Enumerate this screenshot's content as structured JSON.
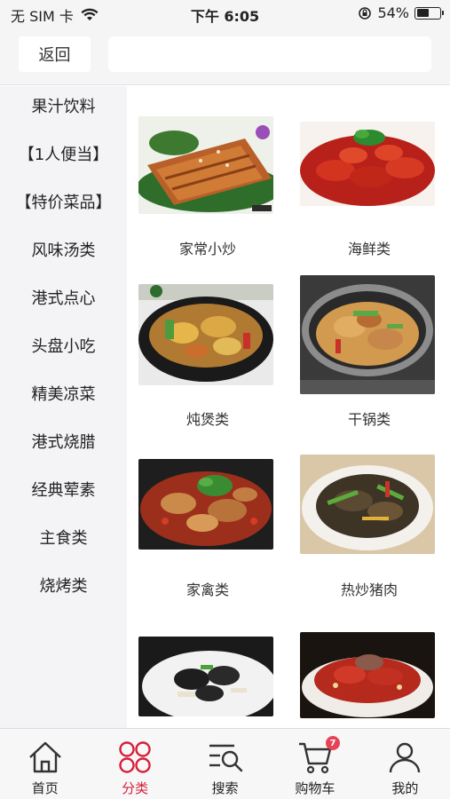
{
  "status_bar": {
    "carrier": "无 SIM 卡",
    "time": "下午 6:05",
    "battery_percent": "54%",
    "battery_level": 0.54
  },
  "nav": {
    "back_label": "返回",
    "search_placeholder": ""
  },
  "sidebar": {
    "items": [
      {
        "label": "果汁饮料"
      },
      {
        "label": "【1人便当】"
      },
      {
        "label": "【特价菜品】"
      },
      {
        "label": "风味汤类"
      },
      {
        "label": "港式点心"
      },
      {
        "label": "头盘小吃"
      },
      {
        "label": "精美凉菜"
      },
      {
        "label": "港式烧腊"
      },
      {
        "label": "经典荤素"
      },
      {
        "label": "主食类"
      },
      {
        "label": "烧烤类"
      }
    ]
  },
  "categories": [
    {
      "label": "家常小炒",
      "icon": "fried-tofu-dish-photo"
    },
    {
      "label": "海鲜类",
      "icon": "crayfish-dish-photo"
    },
    {
      "label": "炖煲类",
      "icon": "claypot-stew-photo"
    },
    {
      "label": "干锅类",
      "icon": "dry-pot-tripe-photo"
    },
    {
      "label": "家禽类",
      "icon": "chicken-dish-photo"
    },
    {
      "label": "热炒猪肉",
      "icon": "stir-fried-pork-photo"
    },
    {
      "label": "",
      "icon": "fungus-dish-photo"
    },
    {
      "label": "",
      "icon": "spicy-meat-dish-photo"
    }
  ],
  "tabs": [
    {
      "label": "首页",
      "icon": "home-icon"
    },
    {
      "label": "分类",
      "icon": "category-icon"
    },
    {
      "label": "搜索",
      "icon": "search-icon"
    },
    {
      "label": "购物车",
      "icon": "cart-icon",
      "badge": "7"
    },
    {
      "label": "我的",
      "icon": "profile-icon"
    }
  ],
  "colors": {
    "accent": "#d61f3a",
    "badge": "#e64357"
  }
}
